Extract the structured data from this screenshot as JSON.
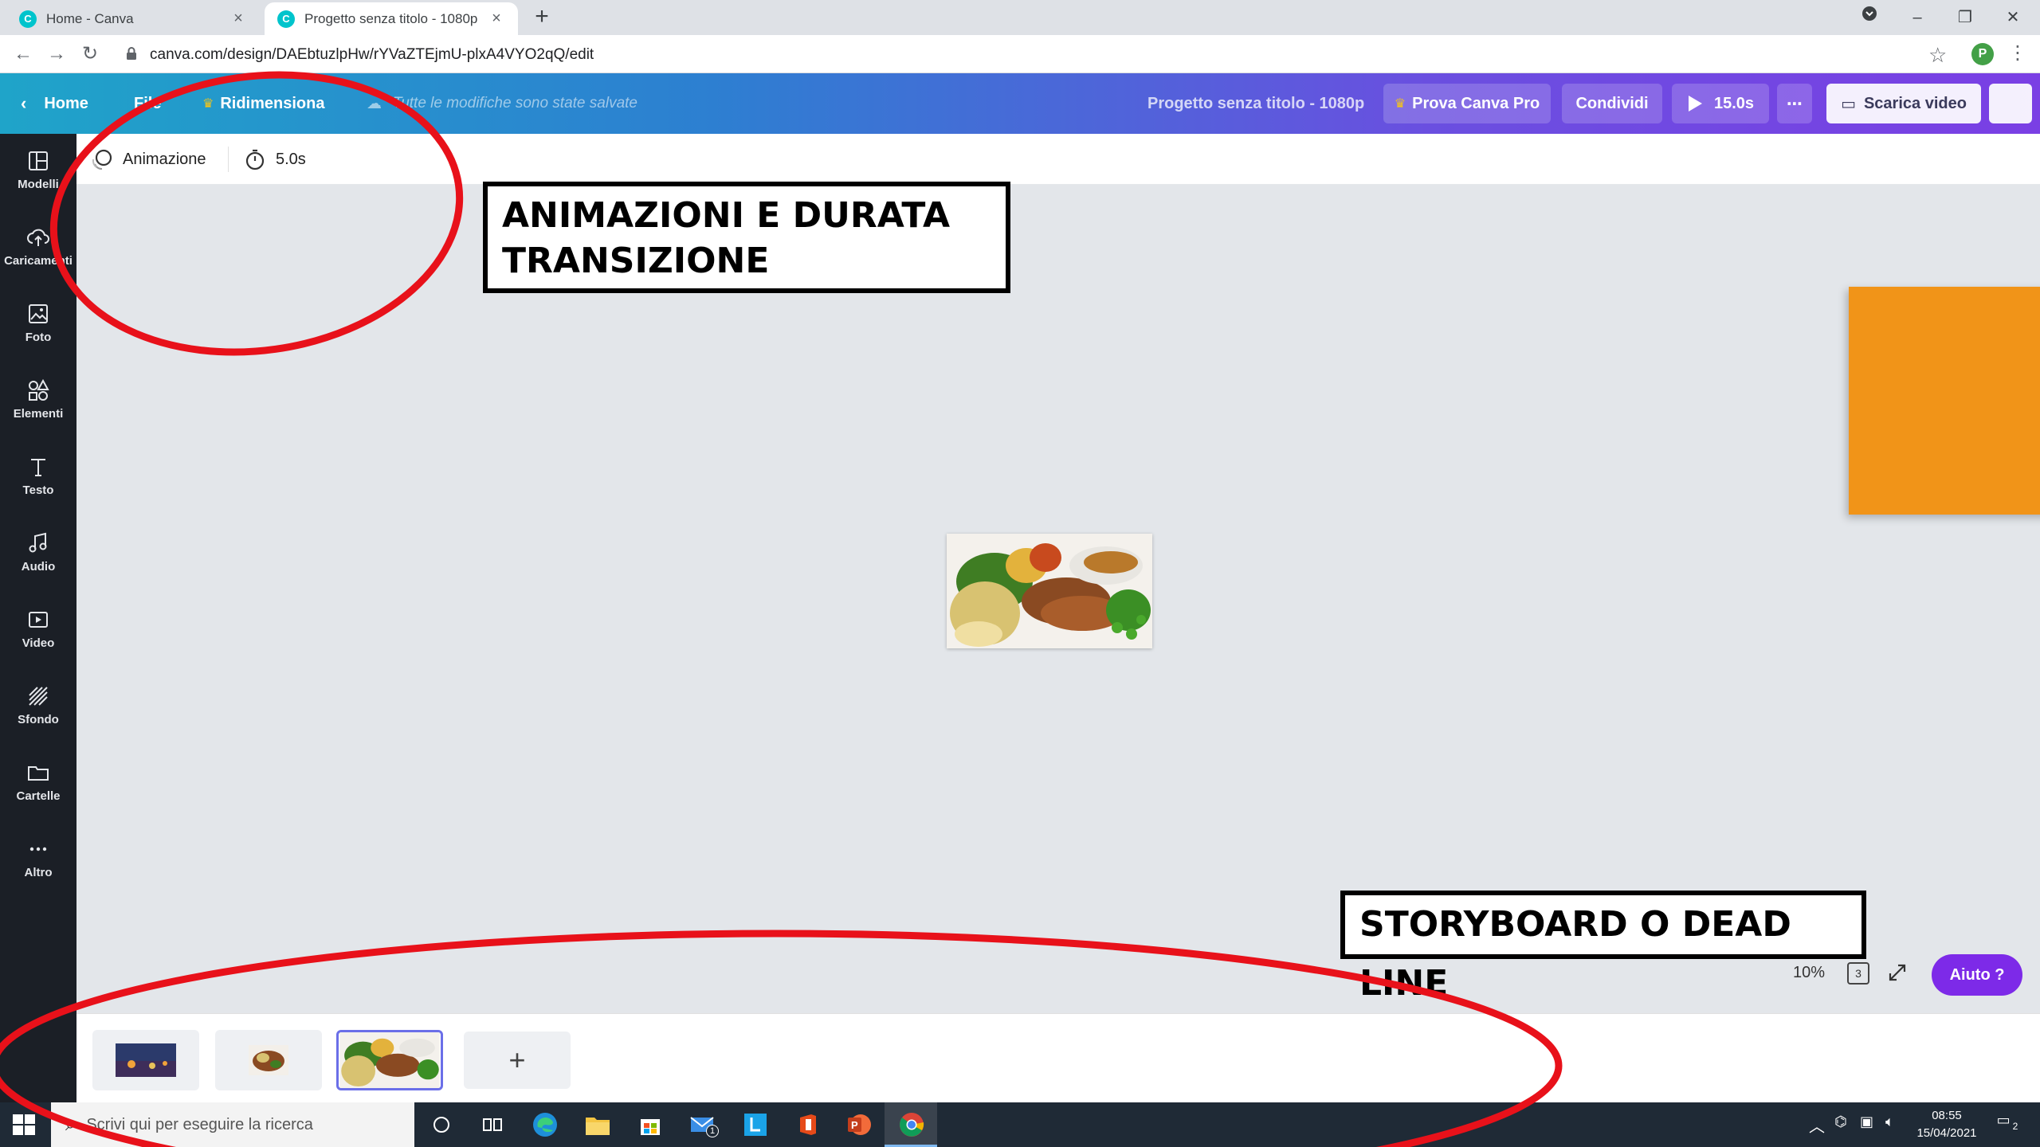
{
  "browser": {
    "tabs": [
      {
        "title": "Home - Canva",
        "active": false
      },
      {
        "title": "Progetto senza titolo - 1080p",
        "active": true
      }
    ],
    "url": "canva.com/design/DAEbtuzlpHw/rYVaZTEjmU-plxA4VYO2qQ/edit",
    "profile_initial": "P"
  },
  "header": {
    "home_label": "Home",
    "file_label": "File",
    "resize_label": "Ridimensiona",
    "saved_status": "Tutte le modifiche sono state salvate",
    "project_title": "Progetto senza titolo - 1080p",
    "pro_button": "Prova Canva Pro",
    "share_button": "Condividi",
    "play_duration": "15.0s",
    "download_button": "Scarica video"
  },
  "sidebar": {
    "items": [
      {
        "label": "Modelli",
        "icon": "layout-icon"
      },
      {
        "label": "Caricamenti",
        "icon": "upload-icon"
      },
      {
        "label": "Foto",
        "icon": "photo-icon"
      },
      {
        "label": "Elementi",
        "icon": "shapes-icon"
      },
      {
        "label": "Testo",
        "icon": "text-icon"
      },
      {
        "label": "Audio",
        "icon": "music-icon"
      },
      {
        "label": "Video",
        "icon": "video-icon"
      },
      {
        "label": "Sfondo",
        "icon": "background-icon"
      },
      {
        "label": "Cartelle",
        "icon": "folder-icon"
      },
      {
        "label": "Altro",
        "icon": "more-icon"
      }
    ]
  },
  "toolbar": {
    "animation_label": "Animazione",
    "duration_label": "5.0s"
  },
  "annotations": {
    "top": "ANIMAZIONI E DURATA TRANSIZIONE",
    "bottom": "STORYBOARD O DEAD LINE"
  },
  "footer": {
    "zoom": "10%",
    "page_count": "3",
    "help_label": "Aiuto ?"
  },
  "storyboard": {
    "pages": [
      {
        "name": "page-1",
        "selected": false
      },
      {
        "name": "page-2",
        "selected": false
      },
      {
        "name": "page-3",
        "selected": true
      }
    ],
    "add_label": "+"
  },
  "taskbar": {
    "search_placeholder": "Scrivi qui per eseguire la ricerca",
    "time": "08:55",
    "date": "15/04/2021",
    "notification_count": "2",
    "mail_badge": "1"
  },
  "colors": {
    "accent_purple": "#7d2ae8",
    "orange_shape": "#f19418",
    "annotation_red": "#e8111a"
  }
}
